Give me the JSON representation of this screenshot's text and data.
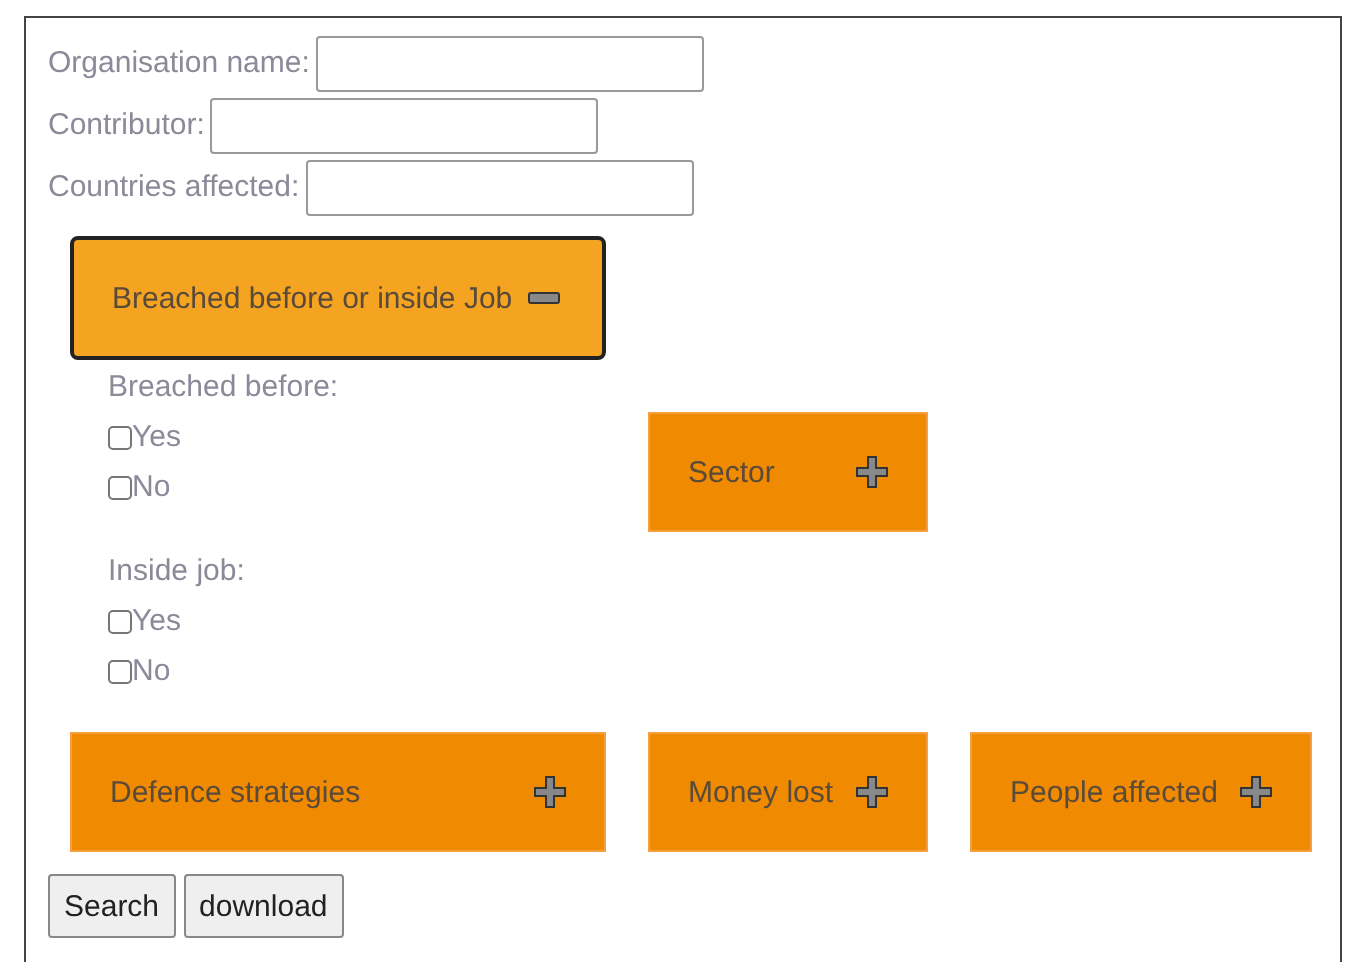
{
  "fields": [
    {
      "label": "Organisation name:"
    },
    {
      "label": "Contributor:"
    },
    {
      "label": "Countries affected:"
    }
  ],
  "sections": [
    {
      "label": "Breached before or inside Job",
      "expanded": true,
      "groups": [
        {
          "label": "Breached before:",
          "options": [
            {
              "label": "Yes",
              "checked": false
            },
            {
              "label": "No",
              "checked": false
            }
          ]
        },
        {
          "label": "Inside job:",
          "options": [
            {
              "label": "Yes",
              "checked": false
            },
            {
              "label": "No",
              "checked": false
            }
          ]
        }
      ]
    },
    {
      "label": "Sector",
      "expanded": false
    },
    {
      "label": "Defence strategies",
      "expanded": false
    },
    {
      "label": "Money lost",
      "expanded": false
    },
    {
      "label": "People affected",
      "expanded": false
    }
  ],
  "buttons": [
    "Search",
    "download"
  ]
}
